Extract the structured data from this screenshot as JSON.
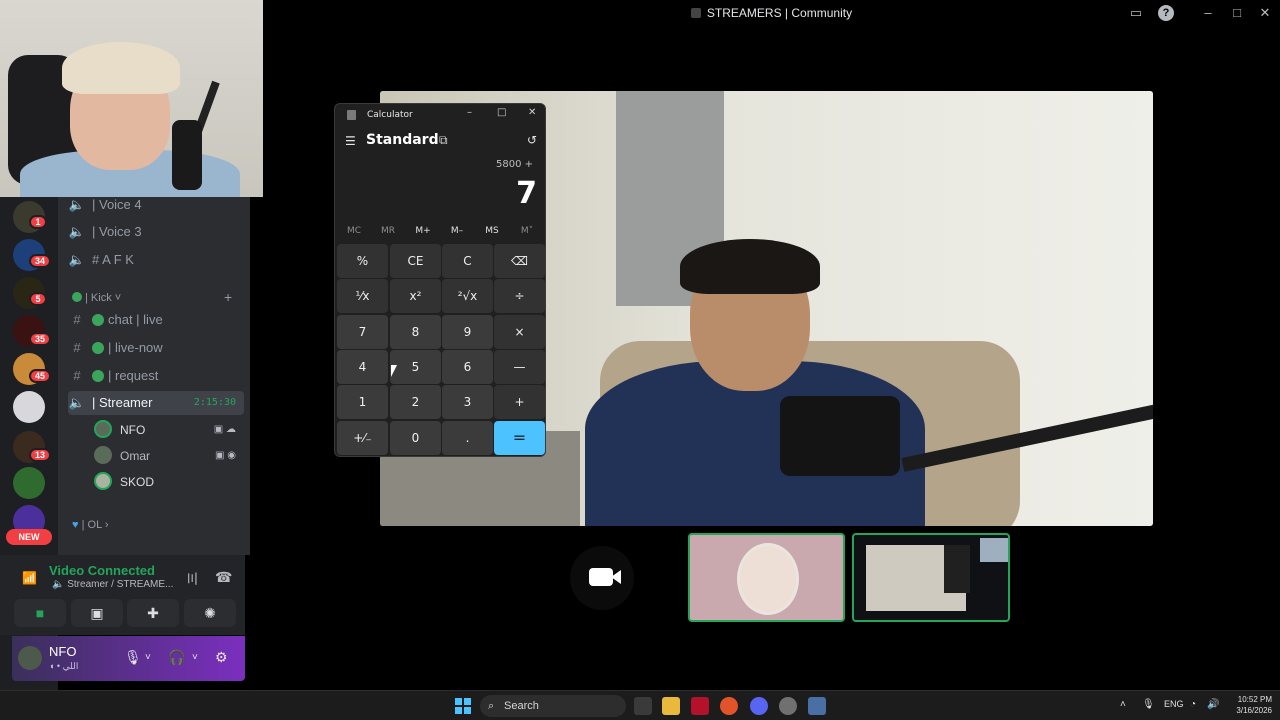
{
  "window": {
    "title": "STREAMERS | Community",
    "inbox_icon": "inbox-icon",
    "help_label": "?",
    "min_icon": "minimize-icon",
    "max_icon": "maximize-icon",
    "close_icon": "close-icon"
  },
  "servers": [
    {
      "badge": "1"
    },
    {
      "badge": "34"
    },
    {
      "badge": "5"
    },
    {
      "badge": "35"
    },
    {
      "badge": "45"
    },
    {
      "badge": ""
    },
    {
      "badge": "13"
    },
    {
      "badge": ""
    },
    {
      "badge": ""
    }
  ],
  "new_label": "NEW",
  "channels": {
    "voice4": "| Voice 4",
    "voice3": "| Voice 3",
    "afk": "# A F K",
    "category_kick": "| Kick",
    "chat_live": "chat | live",
    "live_now": "| live-now",
    "request": "| request",
    "streamer": "| Streamer",
    "streamer_timer": "2:15:30",
    "category_ol": "| OL"
  },
  "members": [
    {
      "name": "NFO"
    },
    {
      "name": "Omar"
    },
    {
      "name": "SKOD"
    }
  ],
  "voice_panel": {
    "status": "Video Connected",
    "channel": "Streamer / STREAME..."
  },
  "user": {
    "name": "NFO",
    "status": "اللي"
  },
  "calculator": {
    "title": "Calculator",
    "mode": "Standard",
    "expression": "5800 +",
    "display": "7",
    "memory": [
      "MC",
      "MR",
      "M+",
      "M–",
      "MS",
      "M˅"
    ],
    "keys": [
      [
        "%",
        "CE",
        "C",
        "⌫"
      ],
      [
        "⅟x",
        "x²",
        "²√x",
        "÷"
      ],
      [
        "7",
        "8",
        "9",
        "×"
      ],
      [
        "4",
        "5",
        "6",
        "—"
      ],
      [
        "1",
        "2",
        "3",
        "+"
      ],
      [
        "+⁄₋",
        "0",
        ".",
        "="
      ]
    ]
  },
  "taskbar": {
    "search": "Search",
    "lang": "ENG",
    "time": "10:52 PM",
    "date": "3/16/2026"
  },
  "colors": {
    "discord_bg": "#2b2d31",
    "rail_bg": "#1e1f22",
    "online": "#23a55a",
    "badge": "#f23f43",
    "calc_accent": "#4cc2ff"
  }
}
